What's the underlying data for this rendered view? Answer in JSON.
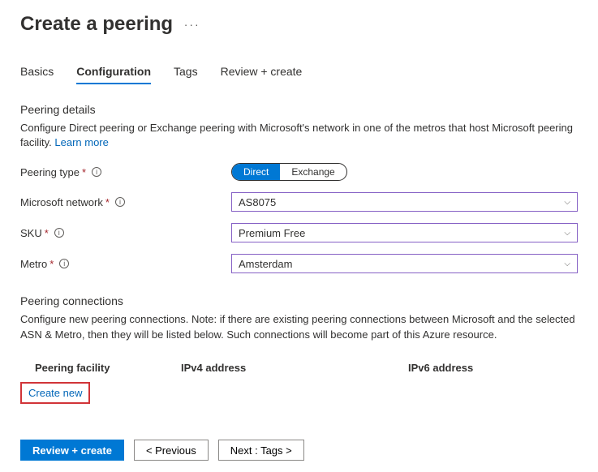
{
  "header": {
    "title": "Create a peering"
  },
  "tabs": {
    "items": [
      {
        "label": "Basics"
      },
      {
        "label": "Configuration"
      },
      {
        "label": "Tags"
      },
      {
        "label": "Review + create"
      }
    ],
    "activeIndex": 1
  },
  "details": {
    "heading": "Peering details",
    "text": "Configure Direct peering or Exchange peering with Microsoft's network in one of the metros that host Microsoft peering facility. ",
    "learnMore": "Learn more"
  },
  "form": {
    "peeringType": {
      "label": "Peering type",
      "options": [
        "Direct",
        "Exchange"
      ],
      "selected": "Direct"
    },
    "msNetwork": {
      "label": "Microsoft network",
      "value": "AS8075"
    },
    "sku": {
      "label": "SKU",
      "value": "Premium Free"
    },
    "metro": {
      "label": "Metro",
      "value": "Amsterdam"
    }
  },
  "connections": {
    "heading": "Peering connections",
    "text": "Configure new peering connections. Note: if there are existing peering connections between Microsoft and the selected ASN & Metro, then they will be listed below. Such connections will become part of this Azure resource.",
    "columns": [
      "Peering facility",
      "IPv4 address",
      "IPv6 address"
    ],
    "createNew": "Create new"
  },
  "footer": {
    "review": "Review + create",
    "prev": "< Previous",
    "next": "Next : Tags >"
  }
}
